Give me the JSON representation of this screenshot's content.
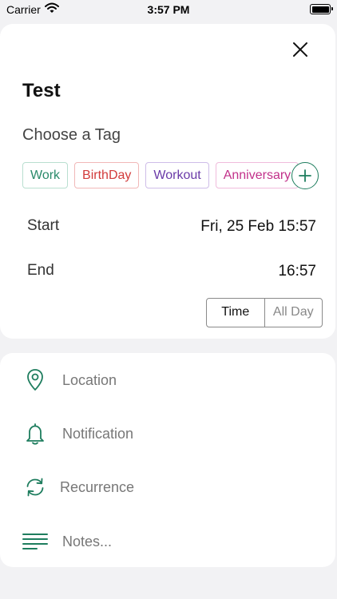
{
  "status_bar": {
    "carrier": "Carrier",
    "time": "3:57 PM"
  },
  "event": {
    "title": "Test",
    "tag_heading": "Choose a Tag",
    "tags": [
      {
        "label": "Work",
        "color": "#2a8a6a"
      },
      {
        "label": "BirthDay",
        "color": "#d23b3b"
      },
      {
        "label": "Workout",
        "color": "#6a3aa8"
      },
      {
        "label": "Anniversary",
        "color": "#c2318a"
      }
    ],
    "start": {
      "label": "Start",
      "value": "Fri, 25 Feb 15:57"
    },
    "end": {
      "label": "End",
      "value": "16:57"
    },
    "mode_toggle": {
      "time_label": "Time",
      "allday_label": "All Day",
      "selected": "Time"
    }
  },
  "options": {
    "location": "Location",
    "notification": "Notification",
    "recurrence": "Recurrence",
    "notes_placeholder": "Notes..."
  },
  "icons": {
    "close": "close-icon",
    "add_tag": "plus-circle-icon",
    "location": "map-pin-icon",
    "notification": "bell-icon",
    "recurrence": "refresh-icon",
    "notes": "lines-icon"
  },
  "colors": {
    "accent": "#1e7d5e",
    "background": "#f2f2f4",
    "card": "#ffffff"
  }
}
